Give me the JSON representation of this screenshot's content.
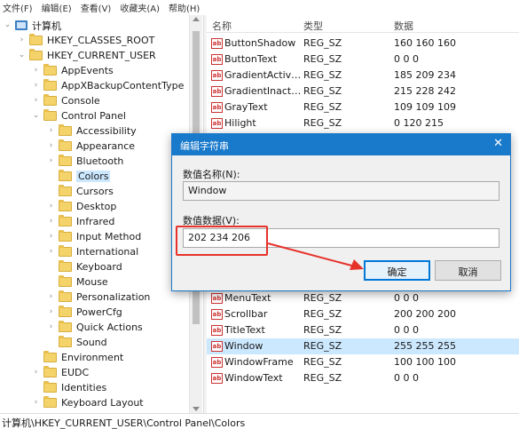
{
  "menubar": {
    "items": [
      "文件(F)",
      "编辑(E)",
      "查看(V)",
      "收藏夹(A)",
      "帮助(H)"
    ]
  },
  "tree": {
    "root": "计算机",
    "items": [
      "HKEY_CLASSES_ROOT",
      "HKEY_CURRENT_USER",
      "AppEvents",
      "AppXBackupContentType",
      "Console",
      "Control Panel",
      "Accessibility",
      "Appearance",
      "Bluetooth",
      "Colors",
      "Cursors",
      "Desktop",
      "Infrared",
      "Input Method",
      "International",
      "Keyboard",
      "Mouse",
      "Personalization",
      "PowerCfg",
      "Quick Actions",
      "Sound",
      "Environment",
      "EUDC",
      "Identities",
      "Keyboard Layout"
    ]
  },
  "list": {
    "headers": {
      "name": "名称",
      "type": "类型",
      "data": "数据"
    },
    "rows": [
      {
        "name": "ButtonShadow",
        "type": "REG_SZ",
        "value": "160 160 160"
      },
      {
        "name": "ButtonText",
        "type": "REG_SZ",
        "value": "0 0 0"
      },
      {
        "name": "GradientActive...",
        "type": "REG_SZ",
        "value": "185 209 234"
      },
      {
        "name": "GradientInacti...",
        "type": "REG_SZ",
        "value": "215 228 242"
      },
      {
        "name": "GrayText",
        "type": "REG_SZ",
        "value": "109 109 109"
      },
      {
        "name": "Hilight",
        "type": "REG_SZ",
        "value": "0 120 215"
      },
      {
        "name": "MenuText",
        "type": "REG_SZ",
        "value": "0 0 0"
      },
      {
        "name": "Scrollbar",
        "type": "REG_SZ",
        "value": "200 200 200"
      },
      {
        "name": "TitleText",
        "type": "REG_SZ",
        "value": "0 0 0"
      },
      {
        "name": "Window",
        "type": "REG_SZ",
        "value": "255 255 255"
      },
      {
        "name": "WindowFrame",
        "type": "REG_SZ",
        "value": "100 100 100"
      },
      {
        "name": "WindowText",
        "type": "REG_SZ",
        "value": "0 0 0"
      }
    ]
  },
  "statusbar": {
    "path": "计算机\\HKEY_CURRENT_USER\\Control Panel\\Colors"
  },
  "dialog": {
    "title": "编辑字符串",
    "name_label": "数值名称(N):",
    "name_value": "Window",
    "data_label": "数值数据(V):",
    "data_value": "202 234 206",
    "ok_label": "确定",
    "cancel_label": "取消",
    "close_glyph": "✕"
  },
  "colors": {
    "accent": "#1979ca",
    "selection": "#cce8ff",
    "annotation": "#e6322b"
  }
}
